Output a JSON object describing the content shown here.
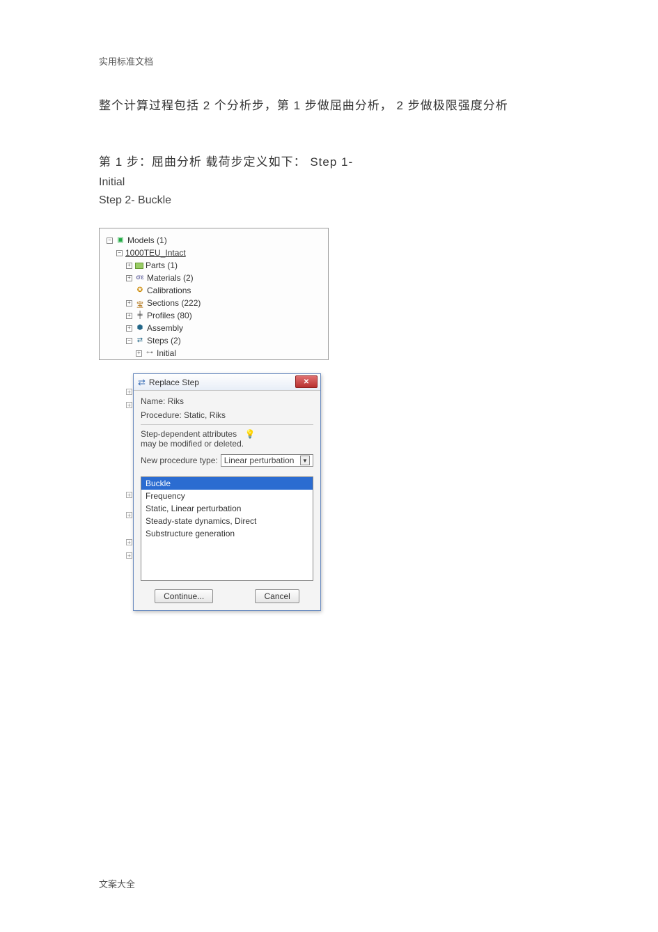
{
  "doc": {
    "header": "实用标准文档",
    "line1": "整个计算过程包括 2 个分析步，第 1 步做屈曲分析，  2 步做极限强度分析",
    "line2": "第 1 步：屈曲分析  载荷步定义如下：  Step 1-",
    "line3": "Initial",
    "line4": "Step 2-  Buckle",
    "footer": "文案大全"
  },
  "tree": {
    "models": "Models (1)",
    "model_name": "1000TEU_Intact",
    "parts": "Parts (1)",
    "materials": "Materials (2)",
    "calibrations": "Calibrations",
    "sections": "Sections (222)",
    "profiles": "Profiles (80)",
    "assembly": "Assembly",
    "steps": "Steps (2)",
    "initial": "Initial"
  },
  "dialog": {
    "title": "Replace Step",
    "name_label": "Name:",
    "name_value": "Riks",
    "proc_label": "Procedure:",
    "proc_value": "Static, Riks",
    "attr1": "Step-dependent attributes",
    "attr2": "may be modified or deleted.",
    "newproc_label": "New procedure type:",
    "newproc_value": "Linear perturbation",
    "options": [
      "Buckle",
      "Frequency",
      "Static, Linear perturbation",
      "Steady-state dynamics, Direct",
      "Substructure generation"
    ],
    "continue_btn": "Continue...",
    "cancel_btn": "Cancel"
  }
}
